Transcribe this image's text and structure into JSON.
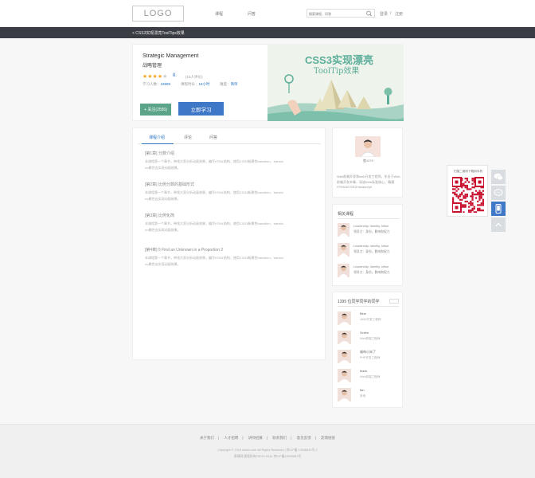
{
  "header": {
    "logo": "LOGO",
    "nav": [
      "课程",
      "问答"
    ],
    "search_placeholder": "搜索课程、问答",
    "login": "登录",
    "separator": "/",
    "register": "注册"
  },
  "breadcrumb": "<  CSS3实现漂亮ToolTips效果",
  "course": {
    "title_en": "Strategic Management",
    "title_zh": "战略管理",
    "stars_filled": "★★★★",
    "stars_empty": "★",
    "rating": 4,
    "score": "8.",
    "ratings": "(15人评价)",
    "students_label": "学习人数：",
    "students": "19989",
    "duration_label": "课程时长：",
    "duration": "18小时",
    "difficulty_label": "难度：",
    "difficulty": "简单",
    "follow_button": "+ 关注(2555)",
    "learn_button": "立即学习",
    "banner_title1": "CSS3实现漂亮",
    "banner_title2": "ToolTip效果"
  },
  "tabs": [
    "课程介绍",
    "评论",
    "问答"
  ],
  "chapters": [
    {
      "title": "[第1章] 分数介绍",
      "desc1": "本课程第一个章节，带领大家分析动画效果，编写HTML结构，使用CSS3新属性transition、transfo",
      "desc2": "rm属性去实现动画效果。"
    },
    {
      "title": "[第2章] 比例分数的基础形式",
      "desc1": "本课程第一个章节，带领大家分析动画效果，编写HTML结构，使用CSS3新属性transition、transfo",
      "desc2": "rm属性去实现动画效果。"
    },
    {
      "title": "[第3章] 比例化简",
      "desc1": "本课程第一个章节，带领大家分析动画效果，编写HTML结构，使用CSS3新属性transition、transfo",
      "desc2": "rm属性去实现动画效果。"
    },
    {
      "title": "[第4章] 5 Find an Unknown in a Proportion 2",
      "desc1": "本课程第一个章节，带领大家分析动画效果，编写HTML结构，使用CSS3新属性transition、transfo",
      "desc2": "rm属性去实现动画效果。"
    }
  ],
  "teacher": {
    "name": "傲1070",
    "bio": "Web前端开发和web开发工程师，毕业于Web前端开发本事，深谙Web标准核心，精通HTML5/CSS3/Javascript"
  },
  "related": {
    "heading": "相关课程",
    "items": [
      {
        "line1": "Leadership: Identity, Influe",
        "line2": "领导力：身份，影响和权力"
      },
      {
        "line1": "Leadership: Identity, Influe",
        "line2": "领导力：身份，影响和权力"
      },
      {
        "line1": "Leadership: Identity, Influe",
        "line2": "领导力：身份，影响和权力"
      }
    ]
  },
  "classmates": {
    "heading": "1395 位同学同学的同学",
    "items": [
      {
        "name": "Blue",
        "role": "JAVA开发工程师"
      },
      {
        "name": "Green",
        "role": "Web前端工程师"
      },
      {
        "name": "喵呜小米了",
        "role": "PHP开发工程师"
      },
      {
        "name": "black",
        "role": "Web前端工程师"
      },
      {
        "name": "fan",
        "role": "其他"
      }
    ]
  },
  "qr": {
    "text": "扫描二维码下载到手机"
  },
  "footer": {
    "links": [
      "关于我们",
      "人才招聘",
      "讲师招募",
      "联系我们",
      "意见反馈",
      "友情链接"
    ],
    "copy1": "Copyright © 2015 imooc.com All Rights Reserved | 京ICP备 13046642号-2",
    "copy2": "慕课网 版权所有©2012-2014 京ICP备12003892号"
  }
}
